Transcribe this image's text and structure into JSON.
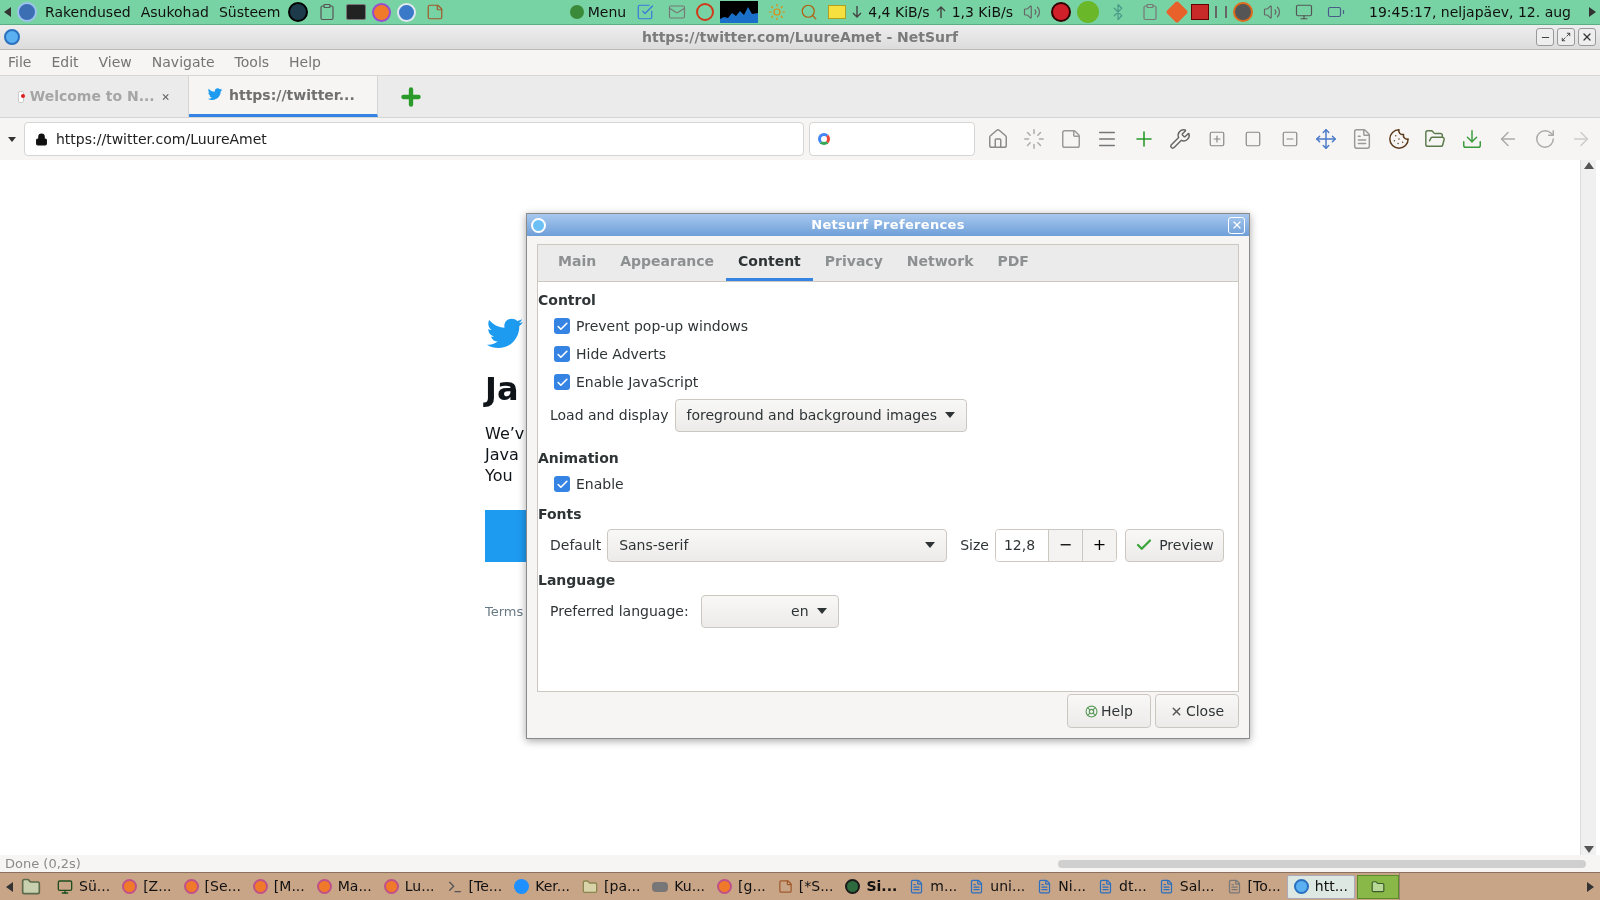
{
  "top_panel": {
    "menus": [
      "Rakendused",
      "Asukohad",
      "Süsteem"
    ],
    "menu_button": "Menu",
    "download_rate": "4,4 KiB/s",
    "upload_rate": "1,3 KiB/s",
    "clock": "19:45:17, neljapäev, 12. aug"
  },
  "window": {
    "title": "https://twitter.com/LuureAmet - NetSurf"
  },
  "menu_bar": [
    "File",
    "Edit",
    "View",
    "Navigate",
    "Tools",
    "Help"
  ],
  "tabs": [
    {
      "label": "Welcome to N...",
      "selected": false
    },
    {
      "label": "https://twitter...",
      "selected": true
    }
  ],
  "address_bar": {
    "url": "https://twitter.com/LuureAmet"
  },
  "page": {
    "heading": "Ja",
    "lines": [
      "We’v",
      "Java",
      "You"
    ],
    "footer_link": "Terms"
  },
  "status_bar": "Done (0,2s)",
  "dialog": {
    "title": "Netsurf Preferences",
    "tabs": [
      {
        "label": "Main",
        "selected": false
      },
      {
        "label": "Appearance",
        "selected": false
      },
      {
        "label": "Content",
        "selected": true
      },
      {
        "label": "Privacy",
        "selected": false
      },
      {
        "label": "Network",
        "selected": false
      },
      {
        "label": "PDF",
        "selected": false
      }
    ],
    "control": {
      "heading": "Control",
      "checkboxes": [
        {
          "label": "Prevent pop-up windows",
          "checked": true
        },
        {
          "label": "Hide Adverts",
          "checked": true
        },
        {
          "label": "Enable JavaScript",
          "checked": true
        }
      ],
      "load_label": "Load and display",
      "load_value": "foreground and background images"
    },
    "animation": {
      "heading": "Animation",
      "checkbox": {
        "label": "Enable",
        "checked": true
      }
    },
    "fonts": {
      "heading": "Fonts",
      "default_label": "Default",
      "default_value": "Sans-serif",
      "size_label": "Size",
      "size_value": "12,8",
      "decrement": "−",
      "increment": "+",
      "preview": "Preview"
    },
    "language": {
      "heading": "Language",
      "label": "Preferred language:",
      "value": "en"
    },
    "buttons": [
      {
        "label": "Help",
        "kind": "help"
      },
      {
        "label": "Close",
        "kind": "close"
      }
    ]
  },
  "taskbar": [
    {
      "label": "Sü...",
      "selected": false,
      "attention": false
    },
    {
      "label": "[Z...",
      "selected": false,
      "attention": false
    },
    {
      "label": "[Se...",
      "selected": false,
      "attention": false
    },
    {
      "label": "[M...",
      "selected": false,
      "attention": false
    },
    {
      "label": "Ma...",
      "selected": false,
      "attention": false
    },
    {
      "label": "Lu...",
      "selected": false,
      "attention": false
    },
    {
      "label": "[Te...",
      "selected": false,
      "attention": false
    },
    {
      "label": "Ker...",
      "selected": false,
      "attention": false
    },
    {
      "label": "[pa...",
      "selected": false,
      "attention": false
    },
    {
      "label": "Ku...",
      "selected": false,
      "attention": false
    },
    {
      "label": "[g...",
      "selected": false,
      "attention": false
    },
    {
      "label": "[*S...",
      "selected": false,
      "attention": false
    },
    {
      "label": "Si...",
      "selected": false,
      "attention": true
    },
    {
      "label": "m...",
      "selected": false,
      "attention": false
    },
    {
      "label": "uni...",
      "selected": false,
      "attention": false
    },
    {
      "label": "Ni...",
      "selected": false,
      "attention": false
    },
    {
      "label": "dt...",
      "selected": false,
      "attention": false
    },
    {
      "label": "Sal...",
      "selected": false,
      "attention": false
    },
    {
      "label": "[To...",
      "selected": false,
      "attention": false
    },
    {
      "label": "htt...",
      "selected": true,
      "attention": false
    }
  ]
}
